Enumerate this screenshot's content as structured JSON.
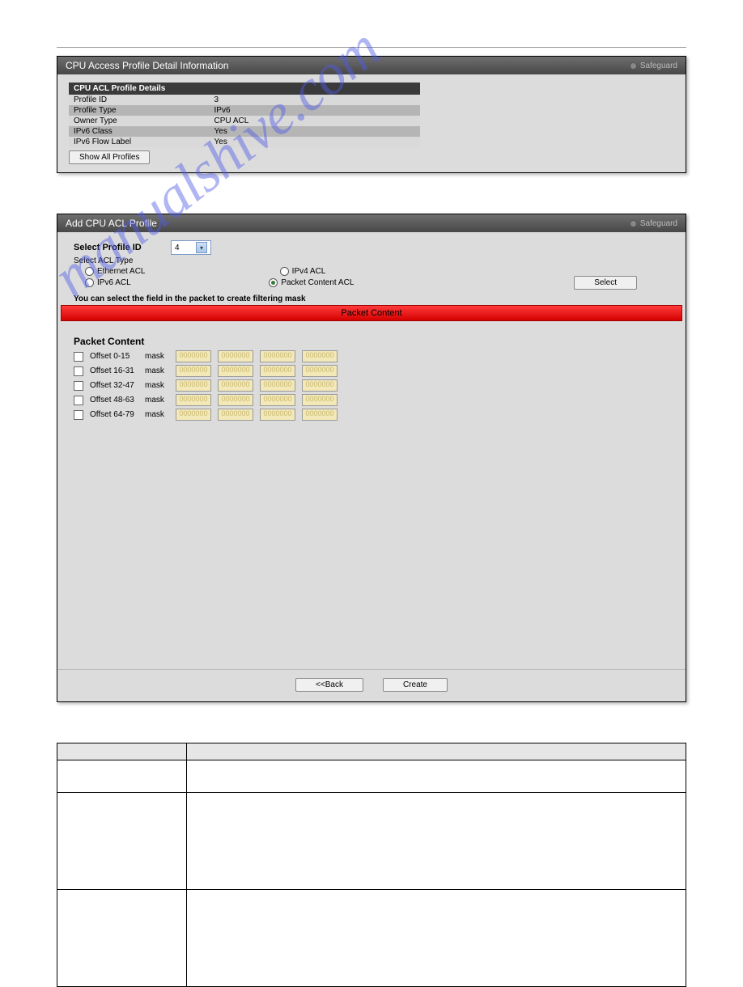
{
  "watermark": "manualshive.com",
  "panel1": {
    "title": "CPU Access Profile Detail Information",
    "safeguard": "Safeguard",
    "tableHeader": "CPU ACL Profile Details",
    "rows": [
      {
        "k": "Profile ID",
        "v": "3"
      },
      {
        "k": "Profile Type",
        "v": "IPv6"
      },
      {
        "k": "Owner Type",
        "v": "CPU ACL"
      },
      {
        "k": "IPv6 Class",
        "v": "Yes"
      },
      {
        "k": "IPv6 Flow Label",
        "v": "Yes"
      }
    ],
    "showAll": "Show All Profiles"
  },
  "panel2": {
    "title": "Add CPU ACL Profile",
    "safeguard": "Safeguard",
    "selectProfileLabel": "Select Profile ID",
    "selectProfileValue": "4",
    "selectAclTypeLabel": "Select ACL Type",
    "radios": {
      "ethernet": "Ethernet ACL",
      "ipv4": "IPv4 ACL",
      "ipv6": "IPv6 ACL",
      "packet": "Packet Content ACL"
    },
    "selectBtn": "Select",
    "hint": "You can select the field in the packet to create filtering mask",
    "redBar": "Packet Content",
    "sectionLabel": "Packet Content",
    "maskLabel": "mask",
    "maskPlaceholder": "0000000",
    "offsets": [
      "Offset 0-15",
      "Offset 16-31",
      "Offset 32-47",
      "Offset 48-63",
      "Offset 64-79"
    ],
    "backBtn": "<<Back",
    "createBtn": "Create"
  },
  "paramTable": {
    "h1": "",
    "h2": "",
    "rows": [
      {
        "p": "",
        "d": ""
      },
      {
        "p": "",
        "d": ""
      },
      {
        "p": "",
        "d": ""
      }
    ]
  }
}
